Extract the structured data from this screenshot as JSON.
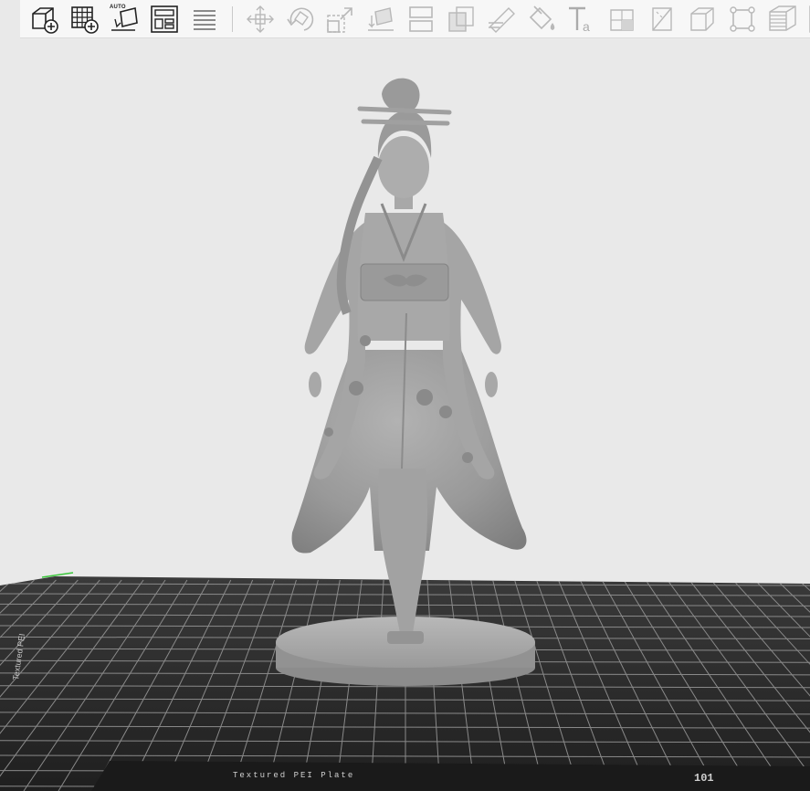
{
  "toolbar": {
    "tools": [
      {
        "name": "add-model",
        "icon": "cube-plus-icon",
        "enabled": true
      },
      {
        "name": "add-plate",
        "icon": "grid-plus-icon",
        "enabled": true
      },
      {
        "name": "auto-orient",
        "icon": "auto-orient-icon",
        "label": "AUTO",
        "enabled": true
      },
      {
        "name": "arrange",
        "icon": "arrange-icon",
        "enabled": true
      },
      {
        "name": "slice-list",
        "icon": "lines-icon",
        "enabled": true
      },
      {
        "name": "move",
        "icon": "move-icon",
        "enabled": false
      },
      {
        "name": "rotate",
        "icon": "rotate-icon",
        "enabled": false
      },
      {
        "name": "scale",
        "icon": "scale-icon",
        "enabled": false
      },
      {
        "name": "lay-on-face",
        "icon": "lay-flat-icon",
        "enabled": false
      },
      {
        "name": "split",
        "icon": "split-icon",
        "enabled": false
      },
      {
        "name": "cut",
        "icon": "cut-icon",
        "enabled": false
      },
      {
        "name": "support-paint",
        "icon": "support-paint-icon",
        "enabled": false
      },
      {
        "name": "color-paint",
        "icon": "paint-bucket-icon",
        "enabled": false
      },
      {
        "name": "text",
        "icon": "text-icon",
        "label": "Ta",
        "enabled": false
      },
      {
        "name": "seam",
        "icon": "seam-icon",
        "enabled": false
      },
      {
        "name": "measure",
        "icon": "measure-icon",
        "enabled": false
      },
      {
        "name": "boolean",
        "icon": "boolean-icon",
        "enabled": false
      },
      {
        "name": "fix-model",
        "icon": "fix-icon",
        "enabled": false
      },
      {
        "name": "layers",
        "icon": "layers-icon",
        "enabled": false
      },
      {
        "name": "assembly",
        "icon": "assembly-icon",
        "enabled": false
      }
    ]
  },
  "scene": {
    "background_color": "#e9e9e9",
    "plate_color": "#2a2a2a",
    "plate_grid_color": "#8a8a8a",
    "model_color": "#9c9c9c",
    "model_description_label": "figurine"
  },
  "plate": {
    "side_label": "Textured PEI",
    "front_label": "Textured PEI Plate",
    "corner_marks": "101"
  }
}
